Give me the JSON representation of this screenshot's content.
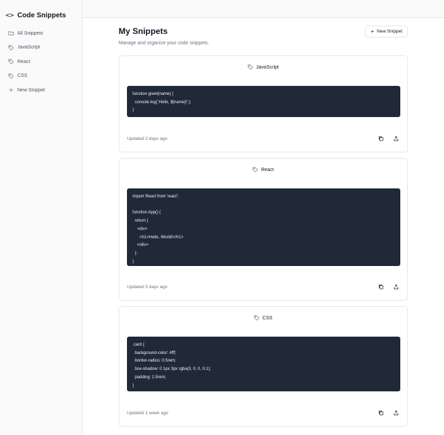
{
  "sidebar": {
    "brand_icon": "<>",
    "title": "Code Snippets",
    "items": [
      {
        "label": "All Snippets",
        "icon": "folder-icon"
      },
      {
        "label": "JavaScript",
        "icon": "tag-icon"
      },
      {
        "label": "React",
        "icon": "tag-icon"
      },
      {
        "label": "CSS",
        "icon": "tag-icon"
      },
      {
        "label": "New Snippet",
        "icon": "plus-icon"
      }
    ]
  },
  "header": {
    "title": "My Snippets",
    "subtitle": "Manage and organize your code snippets.",
    "new_button_label": "New Snippet"
  },
  "snippets": [
    {
      "language": "JavaScript",
      "code": "function greet(name) {\n  console.log(`Hello, ${name}!`);\n}",
      "updated": "Updated 2 days ago"
    },
    {
      "language": "React",
      "code": "import React from 'react';\n\nfunction App() {\n  return (\n    <div>\n      <h1>Hello, World!</h1>\n    </div>\n  );\n}",
      "updated": "Updated 5 days ago"
    },
    {
      "language": "CSS",
      "code": ".card {\n  background-color: #fff;\n  border-radius: 0.5rem;\n  box-shadow: 0 1px 3px rgba(0, 0, 0, 0.1);\n  padding: 1.5rem;\n}",
      "updated": "Updated 1 week ago"
    }
  ],
  "colors": {
    "code_bg": "#1f2937",
    "code_text": "#f3f4f6",
    "border": "#e5e7eb",
    "muted_text": "#6b7280"
  }
}
